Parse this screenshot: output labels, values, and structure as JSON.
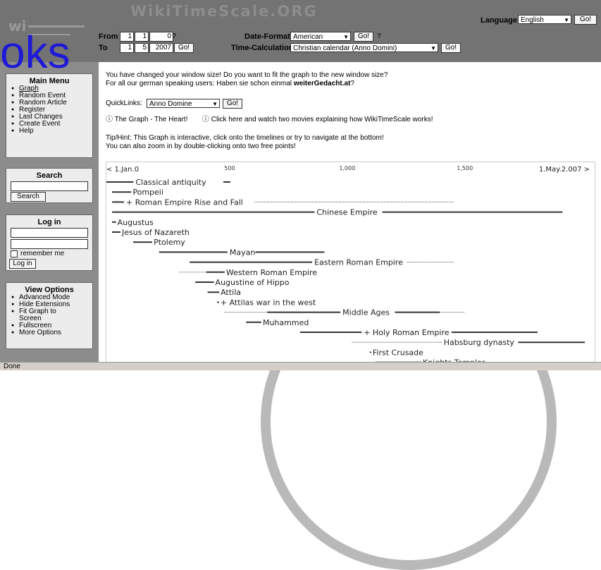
{
  "header": {
    "site_title": "WikiTimeScale.ORG",
    "language_label": "Language",
    "language_value": "English",
    "language_go": "Go!",
    "from_label": "From",
    "to_label": "To",
    "from_day": "1",
    "from_month": "1",
    "from_year": "0",
    "from_help": "?",
    "to_day": "1",
    "to_month": "5",
    "to_year": "2007",
    "to_go": "Go!",
    "date_format_label": "Date-Format",
    "date_format_value": "American",
    "date_format_go": "Go!",
    "date_format_help": "?",
    "time_calc_label": "Time-Calculation",
    "time_calc_value": "Christian calendar (Anno Domini)",
    "time_calc_go": "Go!"
  },
  "overlay_text": "oks",
  "sidebar": {
    "main_menu": {
      "title": "Main Menu",
      "items": [
        "Graph",
        "Random Event",
        "Random Article",
        "Register",
        "Last Changes",
        "Create Event",
        "Help"
      ]
    },
    "search": {
      "title": "Search",
      "input_value": "",
      "button": "Search"
    },
    "login": {
      "title": "Log in",
      "remember": "remember me",
      "button": "Log in"
    },
    "view_options": {
      "title": "View Options",
      "items": [
        "Advanced Mode",
        "Hide Extensions",
        "Fit Graph to Screen",
        "Fullscreen",
        "More Options"
      ]
    }
  },
  "main": {
    "resize_msg": "You have changed your window size! Do you want to fit the graph to the new window size?",
    "german_msg_prefix": "For all our german speaking users: Haben sie schon einmal ",
    "german_msg_bold": "weiterGedacht.at",
    "german_msg_suffix": "?",
    "quicklinks_label": "QuickLinks:",
    "quicklinks_value": "Anno Domine",
    "quicklinks_go": "Go!",
    "graph_link": "The Graph - The Heart!",
    "movies_link": "Click here and watch two movies explaining how WikiTimeScale works!",
    "tip1": "Tip/Hint: This Graph is interactive, click onto the timelines or try to navigate at the bottom!",
    "tip2": "You can also zoom in by double-clicking onto two free points!"
  },
  "timeline": {
    "axis": {
      "start_label": "1.Jan.0",
      "end_label": "1.May.2.007",
      "ticks": [
        "500",
        "1,000",
        "1,500"
      ],
      "tick_years": [
        500,
        1000,
        1500
      ],
      "min": 0,
      "max": 2007
    },
    "events": [
      {
        "label": "Classical antiquity",
        "start": -50,
        "end": 500,
        "core_start": -50,
        "core_end": 500,
        "label_at": 100
      },
      {
        "label": "Pompeii",
        "start": 0,
        "end": 79
      },
      {
        "label": "+ Roman Empire Rise and Fall",
        "start": 0,
        "end": 1453,
        "core_start": 0,
        "core_end": 50,
        "dotted_from": 600,
        "label_at": 60
      },
      {
        "label": "Chinese Empire",
        "start": 0,
        "end": 1912,
        "core_start": 0,
        "core_end": 1912,
        "label_at": 870
      },
      {
        "label": "Augustus",
        "start": 0,
        "end": 14
      },
      {
        "label": "Jesus of Nazareth",
        "start": 0,
        "end": 33
      },
      {
        "label": "Ptolemy",
        "start": 90,
        "end": 168
      },
      {
        "label": "Mayan",
        "start": 200,
        "end": 900,
        "label_at": 500
      },
      {
        "label": "Eastern Roman Empire",
        "start": 330,
        "end": 1453,
        "core_start": 330,
        "core_end": 850,
        "label_at": 860
      },
      {
        "label": "Western Roman Empire",
        "start": 286,
        "end": 476,
        "core_start": 400,
        "core_end": 476
      },
      {
        "label": "Augustine of Hippo",
        "start": 354,
        "end": 430
      },
      {
        "label": "Attila",
        "start": 406,
        "end": 453
      },
      {
        "label": "+ Attilas war in the west",
        "start": 447,
        "end": 452
      },
      {
        "label": "Middle Ages",
        "start": 476,
        "end": 1500,
        "core_start": 660,
        "core_end": 1390,
        "label_at": 980
      },
      {
        "label": "Muhammed",
        "start": 570,
        "end": 632
      },
      {
        "label": "+ Holy Roman Empire",
        "start": 800,
        "end": 1806,
        "core_start": 800,
        "core_end": 1806,
        "label_at": 1070
      },
      {
        "label": "Habsburg dynasty",
        "start": 1020,
        "end": 2007,
        "core_start": 1400,
        "core_end": 2007,
        "label_at": 1410
      },
      {
        "label": "First Crusade",
        "start": 1096,
        "end": 1099
      },
      {
        "label": "Knights Templar",
        "start": 1119,
        "end": 1312
      }
    ]
  },
  "status": {
    "text": "Done"
  },
  "colors": {
    "header_bg": "#737373",
    "sidebar_bg": "#8c8c8c",
    "box_bg": "#ececec",
    "overlay_text": "#1e19d6",
    "status_bg": "#d4d0c8"
  }
}
